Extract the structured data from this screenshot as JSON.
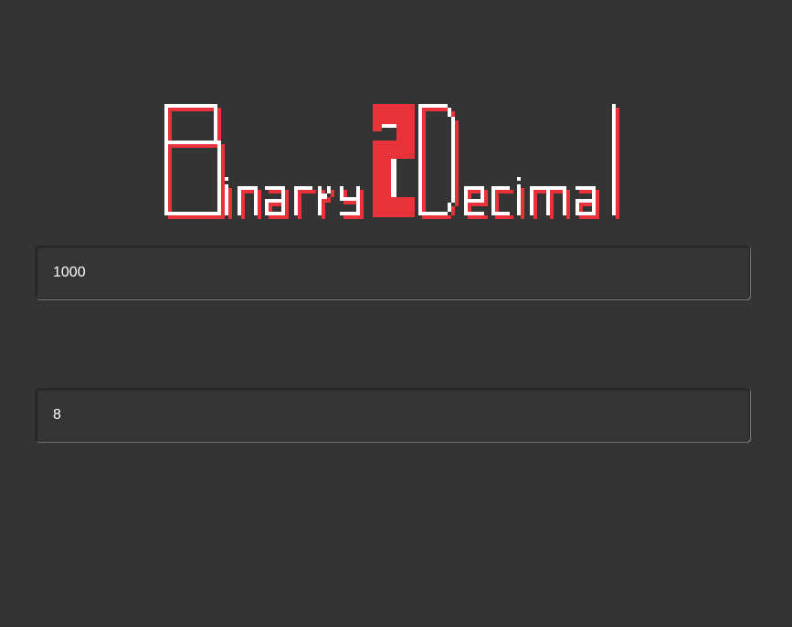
{
  "logo": {
    "text": "Binary2Decimal",
    "primary_color": "#ffffff",
    "accent_color": "#e8323a"
  },
  "binary_input": {
    "value": "1000"
  },
  "decimal_output": {
    "value": "8"
  },
  "colors": {
    "background": "#353434",
    "accent": "#e8323a"
  }
}
